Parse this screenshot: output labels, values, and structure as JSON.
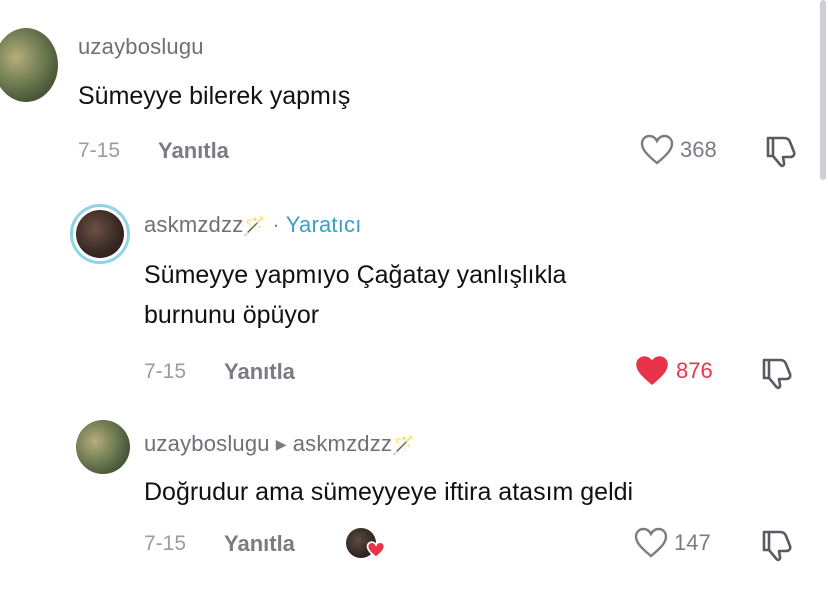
{
  "comments": [
    {
      "username": "uzayboslugu",
      "text": "Sümeyye bilerek yapmış",
      "date": "7-15",
      "reply_label": "Yanıtla",
      "likes": "368",
      "liked": false
    },
    {
      "username": "askmzdzz",
      "wand": "🪄",
      "separator": "·",
      "badge": "Yaratıcı",
      "text_line1": "Sümeyye yapmıyo Çağatay yanlışlıkla",
      "text_line2": "burnunu öpüyor",
      "date": "7-15",
      "reply_label": "Yanıtla",
      "likes": "876",
      "liked": true
    },
    {
      "username": "uzayboslugu",
      "reply_to": "askmzdzz",
      "wand": "🪄",
      "text": "Doğrudur ama sümeyyeye iftira atasım geldi",
      "date": "7-15",
      "reply_label": "Yanıtla",
      "likes": "147",
      "liked": false
    }
  ],
  "colors": {
    "heart_liked": "#e8334a",
    "creator_badge": "#3aa0c8"
  }
}
